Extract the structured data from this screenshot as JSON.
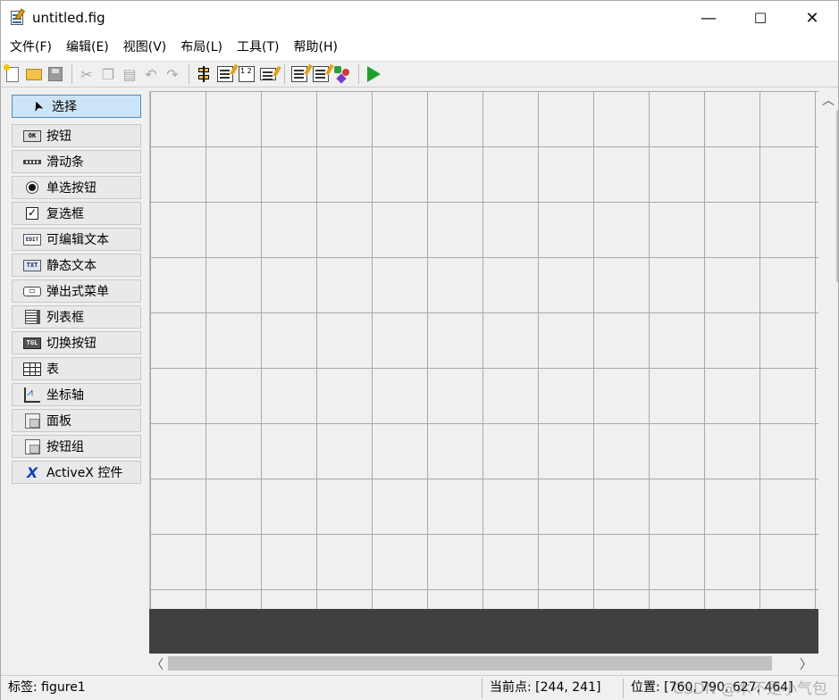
{
  "window": {
    "title": "untitled.fig",
    "controls": {
      "minimize": "—",
      "maximize": "☐",
      "close": "✕"
    }
  },
  "menu": [
    {
      "label": "文件(F)"
    },
    {
      "label": "编辑(E)"
    },
    {
      "label": "视图(V)"
    },
    {
      "label": "布局(L)"
    },
    {
      "label": "工具(T)"
    },
    {
      "label": "帮助(H)"
    }
  ],
  "toolbar": {
    "icons": [
      "new-file-icon",
      "open-folder-icon",
      "save-icon",
      "cut-icon",
      "copy-icon",
      "paste-icon",
      "undo-icon",
      "redo-icon",
      "align-objects-icon",
      "menu-editor-icon",
      "tab-order-icon",
      "toolbar-editor-icon",
      "editor-icon",
      "property-inspector-icon",
      "object-browser-icon",
      "run-figure-icon"
    ],
    "tab_order_glyph": "1 2"
  },
  "palette": {
    "items": [
      {
        "label": "选择",
        "icon": "arrow-pointer-icon",
        "glyph": "➤"
      },
      {
        "label": "按钮",
        "icon": "push-button-icon",
        "glyph": "OK"
      },
      {
        "label": "滑动条",
        "icon": "slider-icon"
      },
      {
        "label": "单选按钮",
        "icon": "radio-button-icon"
      },
      {
        "label": "复选框",
        "icon": "checkbox-icon",
        "glyph": "✓"
      },
      {
        "label": "可编辑文本",
        "icon": "edit-text-icon",
        "glyph": "EDIT"
      },
      {
        "label": "静态文本",
        "icon": "static-text-icon",
        "glyph": "TXT"
      },
      {
        "label": "弹出式菜单",
        "icon": "popup-menu-icon",
        "glyph": "▭"
      },
      {
        "label": "列表框",
        "icon": "listbox-icon"
      },
      {
        "label": "切换按钮",
        "icon": "toggle-button-icon",
        "glyph": "TGL"
      },
      {
        "label": "表",
        "icon": "table-icon"
      },
      {
        "label": "坐标轴",
        "icon": "axes-icon"
      },
      {
        "label": "面板",
        "icon": "panel-icon"
      },
      {
        "label": "按钮组",
        "icon": "button-group-icon"
      },
      {
        "label": "ActiveX 控件",
        "icon": "activex-icon",
        "glyph": "X"
      }
    ]
  },
  "scroll": {
    "up": "︿",
    "left": "〈",
    "right": "〉"
  },
  "status": {
    "tag": "标签: figure1",
    "current_point": "当前点:  [244, 241]",
    "position": "位置: [760, 790, 627, 464]"
  },
  "watermark": "CSDN @木不是小气包"
}
